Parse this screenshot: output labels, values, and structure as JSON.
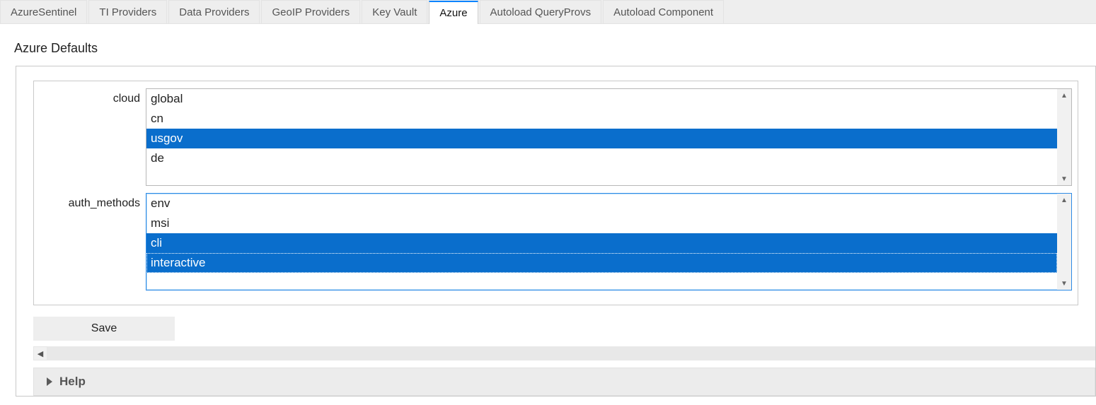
{
  "tabs": [
    {
      "label": "AzureSentinel",
      "active": false
    },
    {
      "label": "TI Providers",
      "active": false
    },
    {
      "label": "Data Providers",
      "active": false
    },
    {
      "label": "GeoIP Providers",
      "active": false
    },
    {
      "label": "Key Vault",
      "active": false
    },
    {
      "label": "Azure",
      "active": true
    },
    {
      "label": "Autoload QueryProvs",
      "active": false
    },
    {
      "label": "Autoload Component",
      "active": false
    }
  ],
  "section": {
    "title": "Azure Defaults"
  },
  "fields": {
    "cloud": {
      "label": "cloud",
      "options": [
        {
          "value": "global",
          "selected": false
        },
        {
          "value": "cn",
          "selected": false
        },
        {
          "value": "usgov",
          "selected": true
        },
        {
          "value": "de",
          "selected": false
        }
      ],
      "focused": false
    },
    "auth_methods": {
      "label": "auth_methods",
      "options": [
        {
          "value": "env",
          "selected": false
        },
        {
          "value": "msi",
          "selected": false
        },
        {
          "value": "cli",
          "selected": true
        },
        {
          "value": "interactive",
          "selected": true,
          "focus_row": true
        }
      ],
      "focused": true
    }
  },
  "buttons": {
    "save": "Save"
  },
  "accordion": {
    "help_label": "Help",
    "expanded": false
  },
  "colors": {
    "accent": "#0a6ecc",
    "tab_accent": "#0a84ff"
  }
}
